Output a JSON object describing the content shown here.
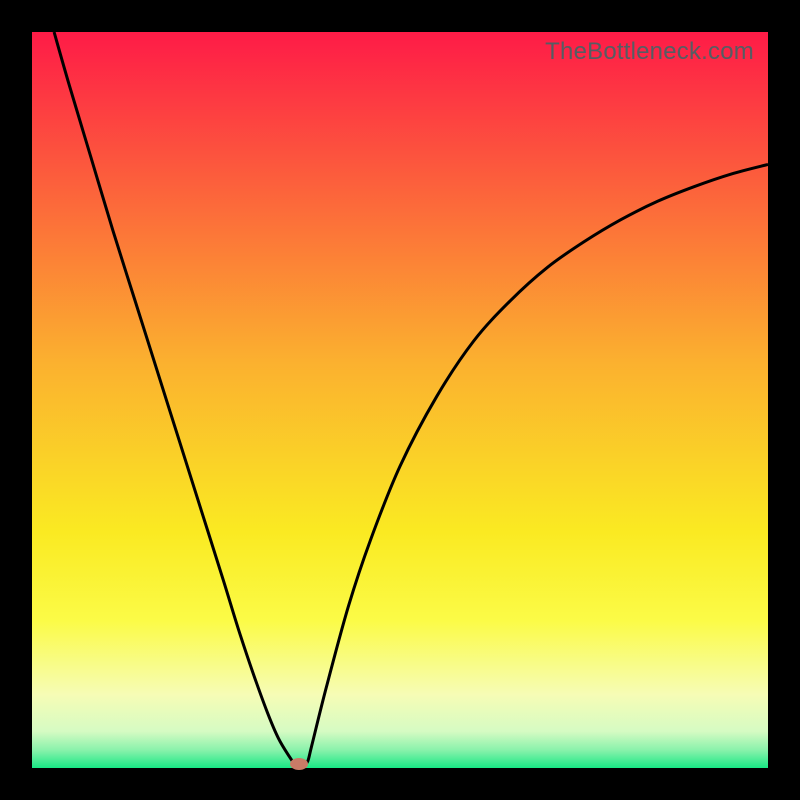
{
  "watermark": "TheBottleneck.com",
  "chart_data": {
    "type": "line",
    "title": "",
    "xlabel": "",
    "ylabel": "",
    "xlim": [
      0,
      100
    ],
    "ylim": [
      0,
      100
    ],
    "x": [
      3,
      5,
      8,
      11,
      14,
      17,
      20,
      23,
      26,
      28,
      30,
      32,
      33.5,
      35,
      35.8,
      36.2,
      36.5,
      37,
      37.5,
      38,
      40,
      43,
      46,
      50,
      55,
      60,
      65,
      70,
      75,
      80,
      85,
      90,
      95,
      100
    ],
    "values": [
      100,
      93,
      83,
      73,
      63.5,
      54,
      44.5,
      35,
      25.5,
      19,
      13,
      7.5,
      4,
      1.5,
      0.4,
      0.2,
      0.2,
      0.3,
      1,
      3,
      11,
      22,
      31,
      41,
      50.5,
      58,
      63.5,
      68,
      71.5,
      74.5,
      77,
      79,
      80.7,
      82
    ],
    "marker": {
      "x": 36.3,
      "y": 0.6,
      "color": "#c97b67"
    },
    "background_gradient": {
      "from": "top",
      "stops": [
        {
          "pos": 0,
          "color": "#fe1b47"
        },
        {
          "pos": 20,
          "color": "#fc5e3c"
        },
        {
          "pos": 45,
          "color": "#fbb12f"
        },
        {
          "pos": 68,
          "color": "#faea22"
        },
        {
          "pos": 80,
          "color": "#fbfb47"
        },
        {
          "pos": 90,
          "color": "#f6fcb5"
        },
        {
          "pos": 95,
          "color": "#d6fbc3"
        },
        {
          "pos": 97.5,
          "color": "#8cf2ac"
        },
        {
          "pos": 100,
          "color": "#18e885"
        }
      ]
    },
    "curve_stroke": "#000000",
    "curve_stroke_width": 3
  }
}
